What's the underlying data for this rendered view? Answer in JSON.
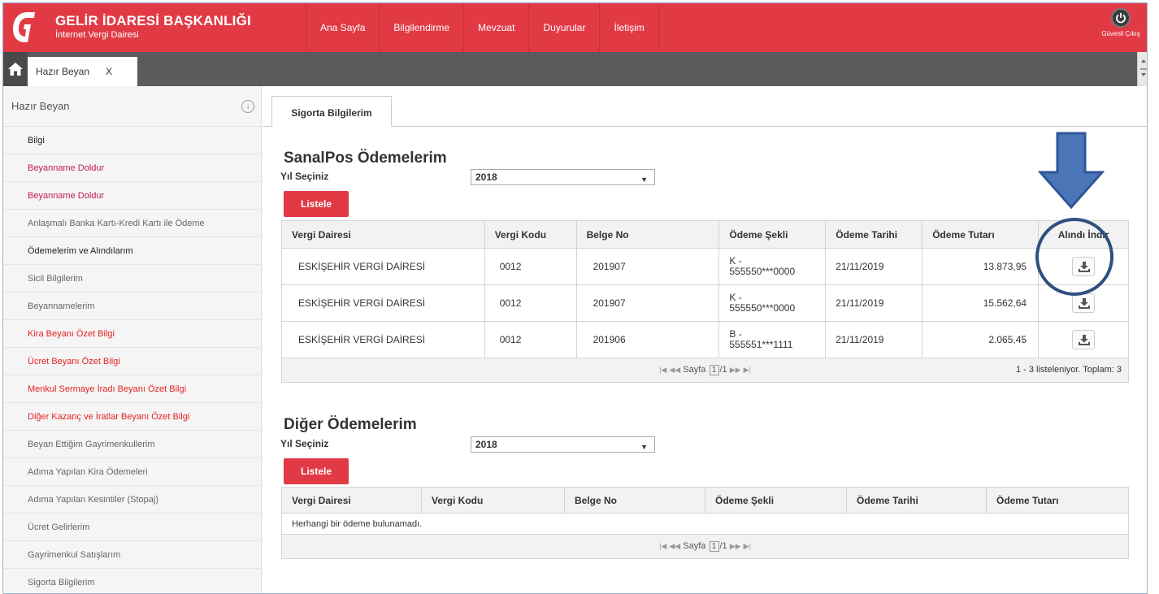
{
  "header": {
    "brand_title": "GELİR İDARESİ BAŞKANLIĞI",
    "brand_subtitle": "İnternet Vergi Dairesi",
    "nav": [
      "Ana Sayfa",
      "Bilgilendirme",
      "Mevzuat",
      "Duyurular",
      "İletişim"
    ],
    "logout_label": "Güvenli Çıkış",
    "accent_color": "#e13a45"
  },
  "tabs": {
    "open_tab_label": "Hazır Beyan",
    "close_label": "X"
  },
  "sidebar": {
    "title": "Hazır Beyan",
    "toggle_glyph": "↓",
    "items": [
      {
        "label": "Bilgi"
      },
      {
        "label": "Beyanname Doldur"
      },
      {
        "label": "Beyanname Doldur"
      },
      {
        "label": "Anlaşmalı Banka Kartı-Kredi Kartı ile Ödeme"
      },
      {
        "label": "Ödemelerim ve Alındılarım"
      },
      {
        "label": "Sicil Bilgilerim"
      },
      {
        "label": "Beyannamelerim"
      },
      {
        "label": "Kira Beyanı Özet Bilgi"
      },
      {
        "label": "Ücret Beyanı Özet Bilgi"
      },
      {
        "label": "Menkul Sermaye İradı Beyanı Özet Bilgi"
      },
      {
        "label": "Diğer Kazanç ve İratlar Beyanı Özet Bilgi"
      },
      {
        "label": "Beyan Ettiğim Gayrimenkullerim"
      },
      {
        "label": "Adıma Yapılan Kira Ödemeleri"
      },
      {
        "label": "Adıma Yapılan Kesintiler (Stopaj)"
      },
      {
        "label": "Ücret Gelirlerim"
      },
      {
        "label": "Gayrimenkul Satışlarım"
      },
      {
        "label": "Sigorta Bilgilerim"
      }
    ]
  },
  "main": {
    "active_tab": "Sigorta Bilgilerim",
    "sanalpos": {
      "title": "SanalPos Ödemelerim",
      "year_label": "Yıl Seçiniz",
      "year_value": "2018",
      "list_button": "Listele",
      "columns": [
        "Vergi Dairesi",
        "Vergi Kodu",
        "Belge No",
        "Ödeme Şekli",
        "Ödeme Tarihi",
        "Ödeme Tutarı",
        "Alındı İndir"
      ],
      "rows": [
        {
          "vergi_dairesi": "ESKİŞEHİR VERGİ DAİRESİ",
          "vergi_kodu": "0012",
          "belge_no": "201907",
          "odeme_sekli_1": "K -",
          "odeme_sekli_2": "555550***0000",
          "odeme_tarihi": "21/11/2019",
          "odeme_tutari": "13.873,95"
        },
        {
          "vergi_dairesi": "ESKİŞEHİR VERGİ DAİRESİ",
          "vergi_kodu": "0012",
          "belge_no": "201907",
          "odeme_sekli_1": "K -",
          "odeme_sekli_2": "555550***0000",
          "odeme_tarihi": "21/11/2019",
          "odeme_tutari": "15.562,64"
        },
        {
          "vergi_dairesi": "ESKİŞEHİR VERGİ DAİRESİ",
          "vergi_kodu": "0012",
          "belge_no": "201906",
          "odeme_sekli_1": "B -",
          "odeme_sekli_2": "555551***1111",
          "odeme_tarihi": "21/11/2019",
          "odeme_tutari": "2.065,45"
        }
      ],
      "pager_label": "Sayfa",
      "pager_page": "1",
      "pager_total": "/1",
      "pager_summary": "1 - 3 listeleniyor. Toplam: 3"
    },
    "diger": {
      "title": "Diğer Ödemelerim",
      "year_label": "Yıl Seçiniz",
      "year_value": "2018",
      "list_button": "Listele",
      "columns": [
        "Vergi Dairesi",
        "Vergi Kodu",
        "Belge No",
        "Ödeme Şekli",
        "Ödeme Tarihi",
        "Ödeme Tutarı"
      ],
      "empty_message": "Herhangi bir ödeme bulunamadı.",
      "pager_label": "Sayfa",
      "pager_page": "1",
      "pager_total": "/1"
    }
  },
  "annotations": {
    "arrow_color": "#4a76b8",
    "circle_color": "#2f4f80"
  }
}
